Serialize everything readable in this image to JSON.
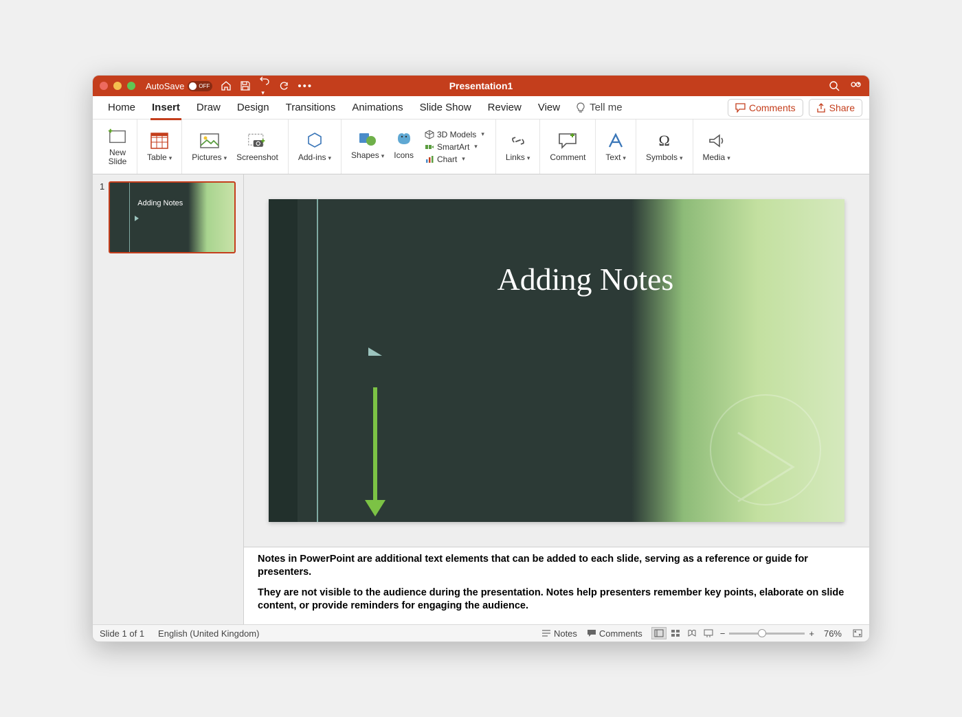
{
  "titlebar": {
    "autosave_label": "AutoSave",
    "autosave_state": "OFF",
    "title": "Presentation1"
  },
  "tabs": {
    "items": [
      "Home",
      "Insert",
      "Draw",
      "Design",
      "Transitions",
      "Animations",
      "Slide Show",
      "Review",
      "View"
    ],
    "active": "Insert",
    "tellme": "Tell me",
    "comments": "Comments",
    "share": "Share"
  },
  "ribbon": {
    "new_slide": "New\nSlide",
    "table": "Table",
    "pictures": "Pictures",
    "screenshot": "Screenshot",
    "addins": "Add-ins",
    "shapes": "Shapes",
    "icons": "Icons",
    "models3d": "3D Models",
    "smartart": "SmartArt",
    "chart": "Chart",
    "links": "Links",
    "comment": "Comment",
    "text": "Text",
    "symbols": "Symbols",
    "media": "Media"
  },
  "thumbnail": {
    "number": "1",
    "title": "Adding Notes"
  },
  "slide": {
    "title": "Adding Notes"
  },
  "notes": {
    "p1": "Notes in PowerPoint are additional text elements that can be added to each slide, serving as a reference or guide for presenters.",
    "p2": "They are not visible to the audience during the presentation. Notes help presenters remember key points, elaborate on slide content, or provide reminders for engaging the audience."
  },
  "statusbar": {
    "slide_count": "Slide 1 of 1",
    "language": "English (United Kingdom)",
    "notes_btn": "Notes",
    "comments_btn": "Comments",
    "zoom_pct": "76%"
  }
}
